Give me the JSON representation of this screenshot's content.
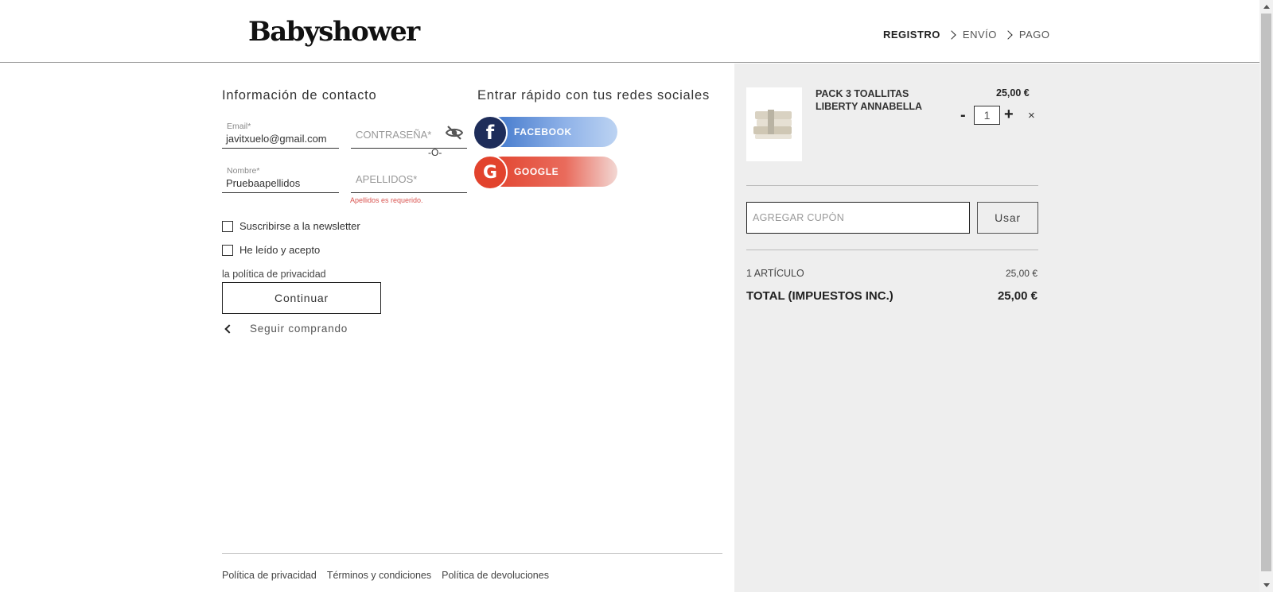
{
  "header": {
    "logo": "Babyshower",
    "steps": [
      {
        "label": "REGISTRO",
        "active": true
      },
      {
        "label": "ENVÍO",
        "active": false
      },
      {
        "label": "PAGO",
        "active": false
      }
    ]
  },
  "contact": {
    "title": "Información de contacto",
    "email": {
      "label": "Email*",
      "value": "javitxuelo@gmail.com"
    },
    "password": {
      "placeholder": "CONTRASEÑA*"
    },
    "or_separator": "-O-",
    "name": {
      "label": "Nombre*",
      "value": "Pruebaapellidos"
    },
    "lastname": {
      "placeholder": "APELLIDOS*",
      "error": "Apellidos es requerido."
    },
    "newsletter_label": "Suscribirse a la newsletter",
    "accept_label": "He leído y acepto",
    "privacy_link": "la política de privacidad",
    "continue_label": "Continuar",
    "keep_shopping_label": "Seguir comprando"
  },
  "social": {
    "title": "Entrar rápido con tus redes sociales",
    "facebook_label": "FACEBOOK",
    "facebook_glyph": "f",
    "google_label": "GOOGLE",
    "google_glyph": "G",
    "colors": {
      "facebook": "#1e2d5a",
      "google": "#e2432d"
    }
  },
  "footer": {
    "links": [
      "Política de privacidad",
      "Términos y condiciones",
      "Política de devoluciones"
    ]
  },
  "cart": {
    "product": {
      "name": "PACK 3 TOALLITAS LIBERTY ANNABELLA",
      "price": "25,00 €",
      "qty_minus": "-",
      "quantity": "1",
      "qty_plus": "+",
      "remove": "×"
    },
    "coupon": {
      "placeholder": "AGREGAR CUPÓN",
      "button_label": "Usar"
    },
    "summary": {
      "items_label": "1 ARTÍCULO",
      "items_value": "25,00 €",
      "total_label": "TOTAL (IMPUESTOS INC.)",
      "total_value": "25,00 €"
    }
  }
}
